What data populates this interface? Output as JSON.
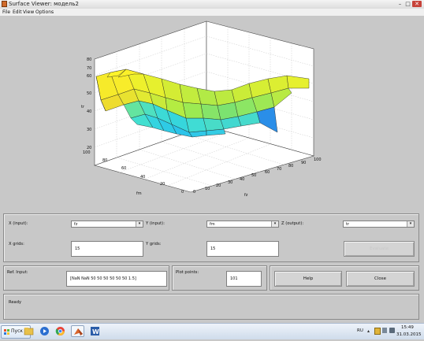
{
  "window": {
    "title": "Surface Viewer: модель2",
    "controls": {
      "minimize": "–",
      "maximize": "□",
      "close": "✕"
    }
  },
  "menu": [
    "File",
    "Edit",
    "View",
    "Options"
  ],
  "plot": {
    "z_label": "tr",
    "x_label": "fz",
    "y_label": "fm",
    "z_ticks": [
      "20",
      "30",
      "40",
      "50",
      "60",
      "70",
      "80"
    ],
    "x_ticks": [
      "0",
      "10",
      "20",
      "30",
      "40",
      "50",
      "60",
      "70",
      "80",
      "90",
      "100"
    ],
    "y_ticks": [
      "0",
      "20",
      "40",
      "60",
      "80",
      "100"
    ]
  },
  "controls": {
    "x_input_label": "X (input):",
    "x_input_value": "fz",
    "y_input_label": "Y (input):",
    "y_input_value": "fm",
    "z_output_label": "Z (output):",
    "z_output_value": "tr",
    "x_grids_label": "X grids:",
    "x_grids_value": "15",
    "y_grids_label": "Y grids:",
    "y_grids_value": "15",
    "evaluate_label": "Evaluate",
    "ref_input_label": "Ref. Input:",
    "ref_input_value": "[NaN NaN 50 50 50 50 50 50 1.5]",
    "plot_points_label": "Plot points:",
    "plot_points_value": "101",
    "help_label": "Help",
    "close_label": "Close",
    "status_text": "Ready"
  },
  "taskbar": {
    "start_label": "Пуск",
    "lang": "RU",
    "time": "15:49",
    "date": "31.03.2015"
  }
}
